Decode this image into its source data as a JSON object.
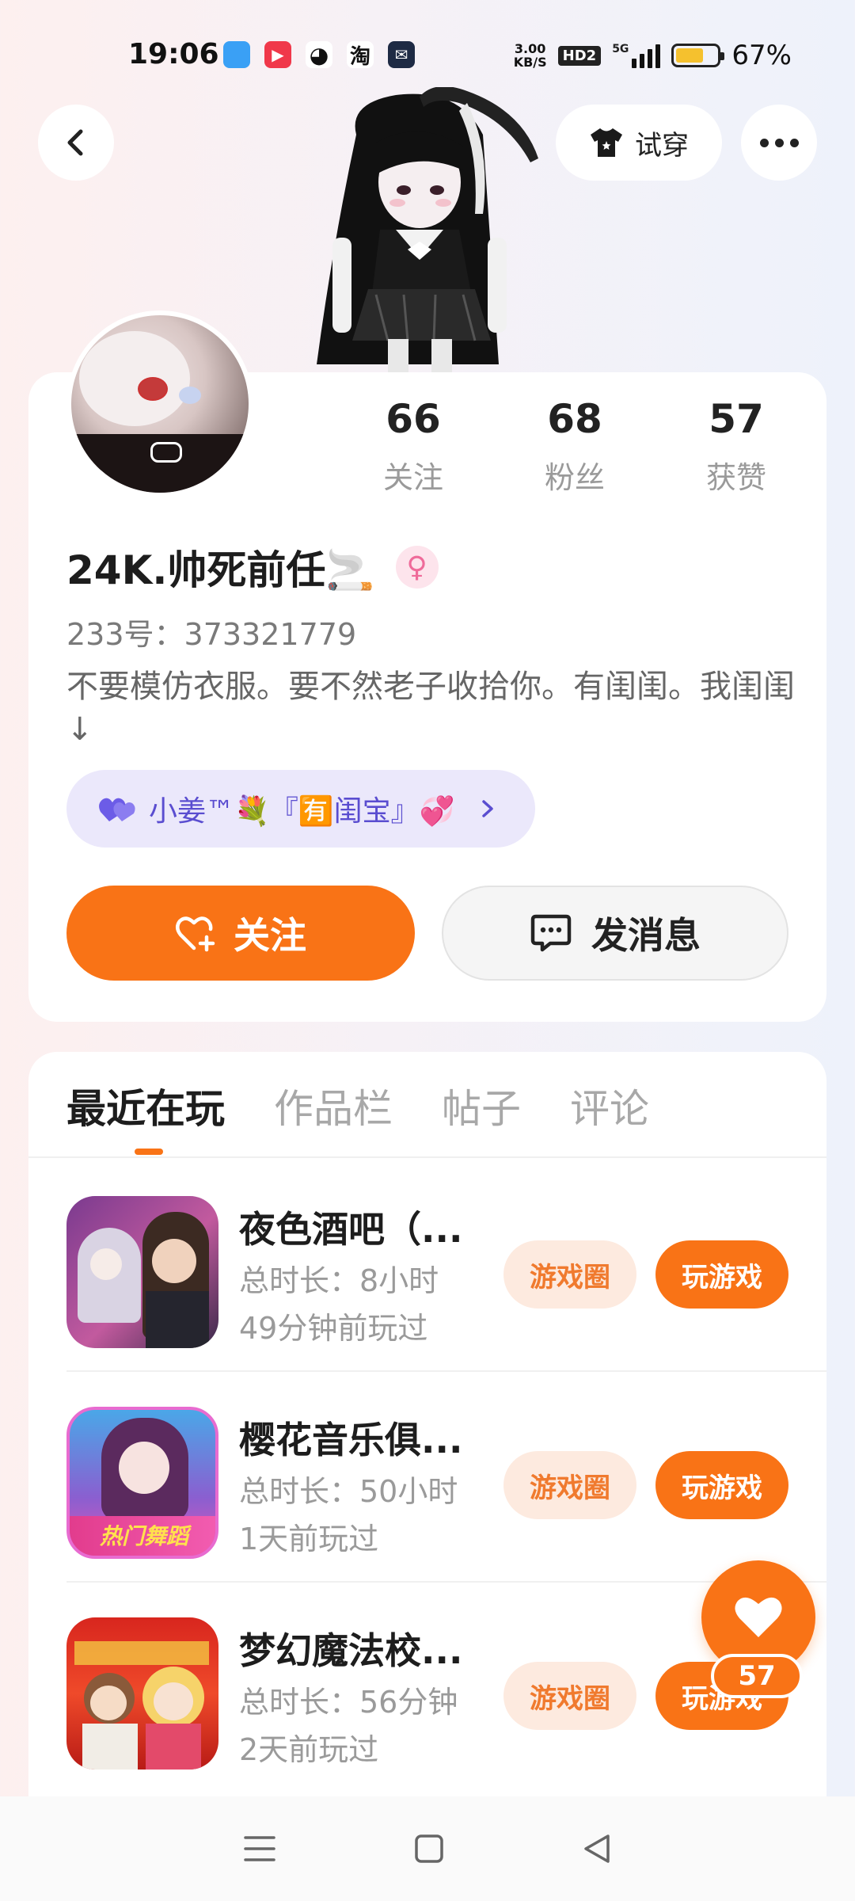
{
  "status_bar": {
    "time": "19:06",
    "net_speed_value": "3.00",
    "net_speed_unit": "KB/S",
    "hd_label": "HD2",
    "network": "5G",
    "battery_percent": "67%",
    "battery_level": 0.67,
    "taobao_label": "淘"
  },
  "header": {
    "tryon_label": "试穿"
  },
  "profile": {
    "stats": [
      {
        "value": "66",
        "label": "关注"
      },
      {
        "value": "68",
        "label": "粉丝"
      },
      {
        "value": "57",
        "label": "获赞"
      }
    ],
    "username": "24K.帅死前任🚬",
    "gender_symbol": "♀",
    "uid": "233号：373321779",
    "bio": "不要模仿衣服。要不然老子收拾你。有闺闺。我闺闺↓",
    "cp_label": "小姜™💐『🈶闺宝』💞",
    "follow_label": "关注",
    "message_label": "发消息"
  },
  "tabs": [
    {
      "label": "最近在玩",
      "active": true
    },
    {
      "label": "作品栏",
      "active": false
    },
    {
      "label": "帖子",
      "active": false
    },
    {
      "label": "评论",
      "active": false
    }
  ],
  "games": [
    {
      "name": "夜色酒吧（...",
      "duration": "总时长：8小时",
      "last_played": "49分钟前玩过",
      "circle_label": "游戏圈",
      "play_label": "玩游戏"
    },
    {
      "name": "樱花音乐俱...",
      "duration": "总时长：50小时",
      "last_played": "1天前玩过",
      "circle_label": "游戏圈",
      "play_label": "玩游戏",
      "icon_text": "热门舞蹈"
    },
    {
      "name": "梦幻魔法校...",
      "duration": "总时长：56分钟",
      "last_played": "2天前玩过",
      "circle_label": "游戏圈",
      "play_label": "玩游戏"
    }
  ],
  "like_fab": {
    "count": "57"
  },
  "colors": {
    "accent": "#f97316",
    "accent_light": "#fdeadf",
    "cp_bg": "#ebe8fb",
    "gender_pink": "#ef6b9a"
  }
}
